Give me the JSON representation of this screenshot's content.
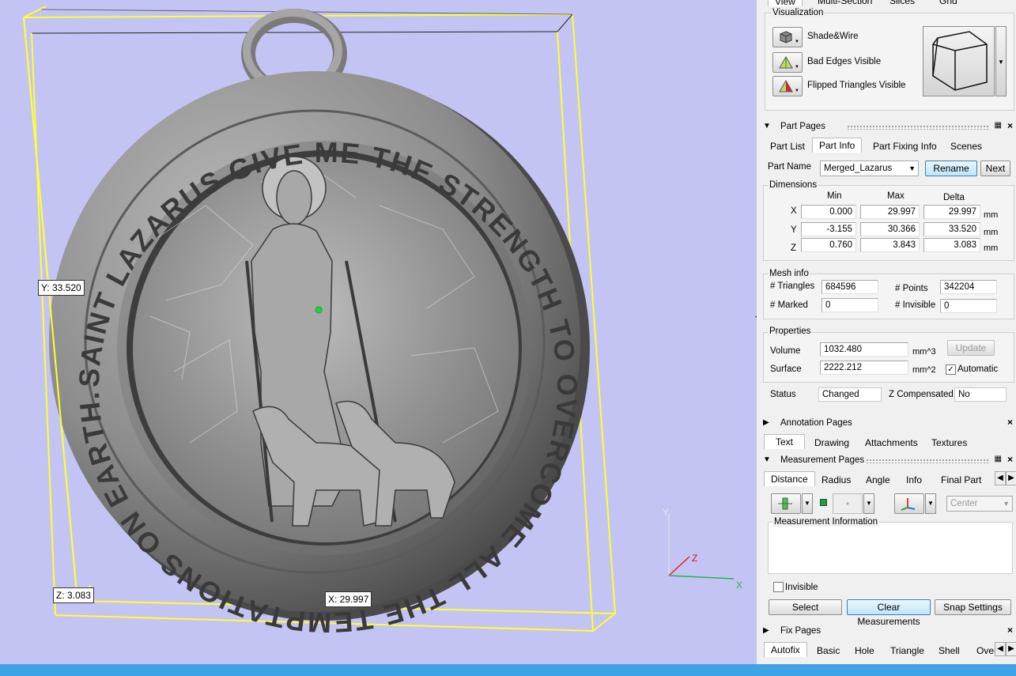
{
  "viewport": {
    "labels": {
      "y": "Y: 33.520",
      "z": "Z: 3.083",
      "x": "X: 29.997"
    },
    "axes": {
      "y": "Y",
      "z": "Z",
      "x": "X"
    },
    "medallion_text": "SAINT LAZARUS GIVE ME THE STRENGTH TO OVERCOME ALL THE TEMPTATIONS ON EARTH.",
    "colors": {
      "background": "#c4c4f4",
      "bbox": "#ffff33",
      "model": "#8a8a8a"
    }
  },
  "top_tabs": [
    "View",
    "Multi-Section",
    "Slices",
    "Grid"
  ],
  "visualization": {
    "title": "Visualization",
    "items": [
      {
        "label": "Shade&Wire",
        "icon": "cube-shade-icon"
      },
      {
        "label": "Bad Edges Visible",
        "icon": "triangle-green-icon"
      },
      {
        "label": "Flipped Triangles Visible",
        "icon": "triangle-red-icon"
      }
    ]
  },
  "part_pages": {
    "title": "Part Pages",
    "tabs": [
      "Part List",
      "Part Info",
      "Part Fixing Info",
      "Scenes"
    ],
    "part_name_label": "Part Name",
    "part_name_value": "Merged_Lazarus",
    "rename": "Rename",
    "next": "Next",
    "dimensions": {
      "title": "Dimensions",
      "headers": [
        "Min",
        "Max",
        "Delta"
      ],
      "unit": "mm",
      "rows": [
        {
          "axis": "X",
          "min": "0.000",
          "max": "29.997",
          "delta": "29.997"
        },
        {
          "axis": "Y",
          "min": "-3.155",
          "max": "30.366",
          "delta": "33.520"
        },
        {
          "axis": "Z",
          "min": "0.760",
          "max": "3.843",
          "delta": "3.083"
        }
      ]
    },
    "mesh": {
      "title": "Mesh info",
      "triangles_label": "# Triangles",
      "triangles": "684596",
      "points_label": "# Points",
      "points": "342204",
      "marked_label": "# Marked",
      "marked": "0",
      "invisible_label": "# Invisible",
      "invisible": "0"
    },
    "properties": {
      "title": "Properties",
      "volume_label": "Volume",
      "volume": "1032.480",
      "volume_unit": "mm^3",
      "surface_label": "Surface",
      "surface": "2222.212",
      "surface_unit": "mm^2",
      "update": "Update",
      "automatic": "Automatic"
    },
    "status_label": "Status",
    "status": "Changed",
    "zcomp_label": "Z Compensated",
    "zcomp": "No"
  },
  "annotation_pages": {
    "title": "Annotation Pages",
    "tabs": [
      "Text",
      "Drawing",
      "Attachments",
      "Textures"
    ]
  },
  "measurement_pages": {
    "title": "Measurement Pages",
    "tabs": [
      "Distance",
      "Radius",
      "Angle",
      "Info",
      "Final Part"
    ],
    "center": "Center",
    "info_title": "Measurement Information",
    "invisible": "Invisible",
    "select": "Select",
    "clear": "Clear Measurements",
    "snap": "Snap Settings"
  },
  "fix_pages": {
    "title": "Fix Pages",
    "tabs": [
      "Autofix",
      "Basic",
      "Hole",
      "Triangle",
      "Shell",
      "Over"
    ]
  }
}
